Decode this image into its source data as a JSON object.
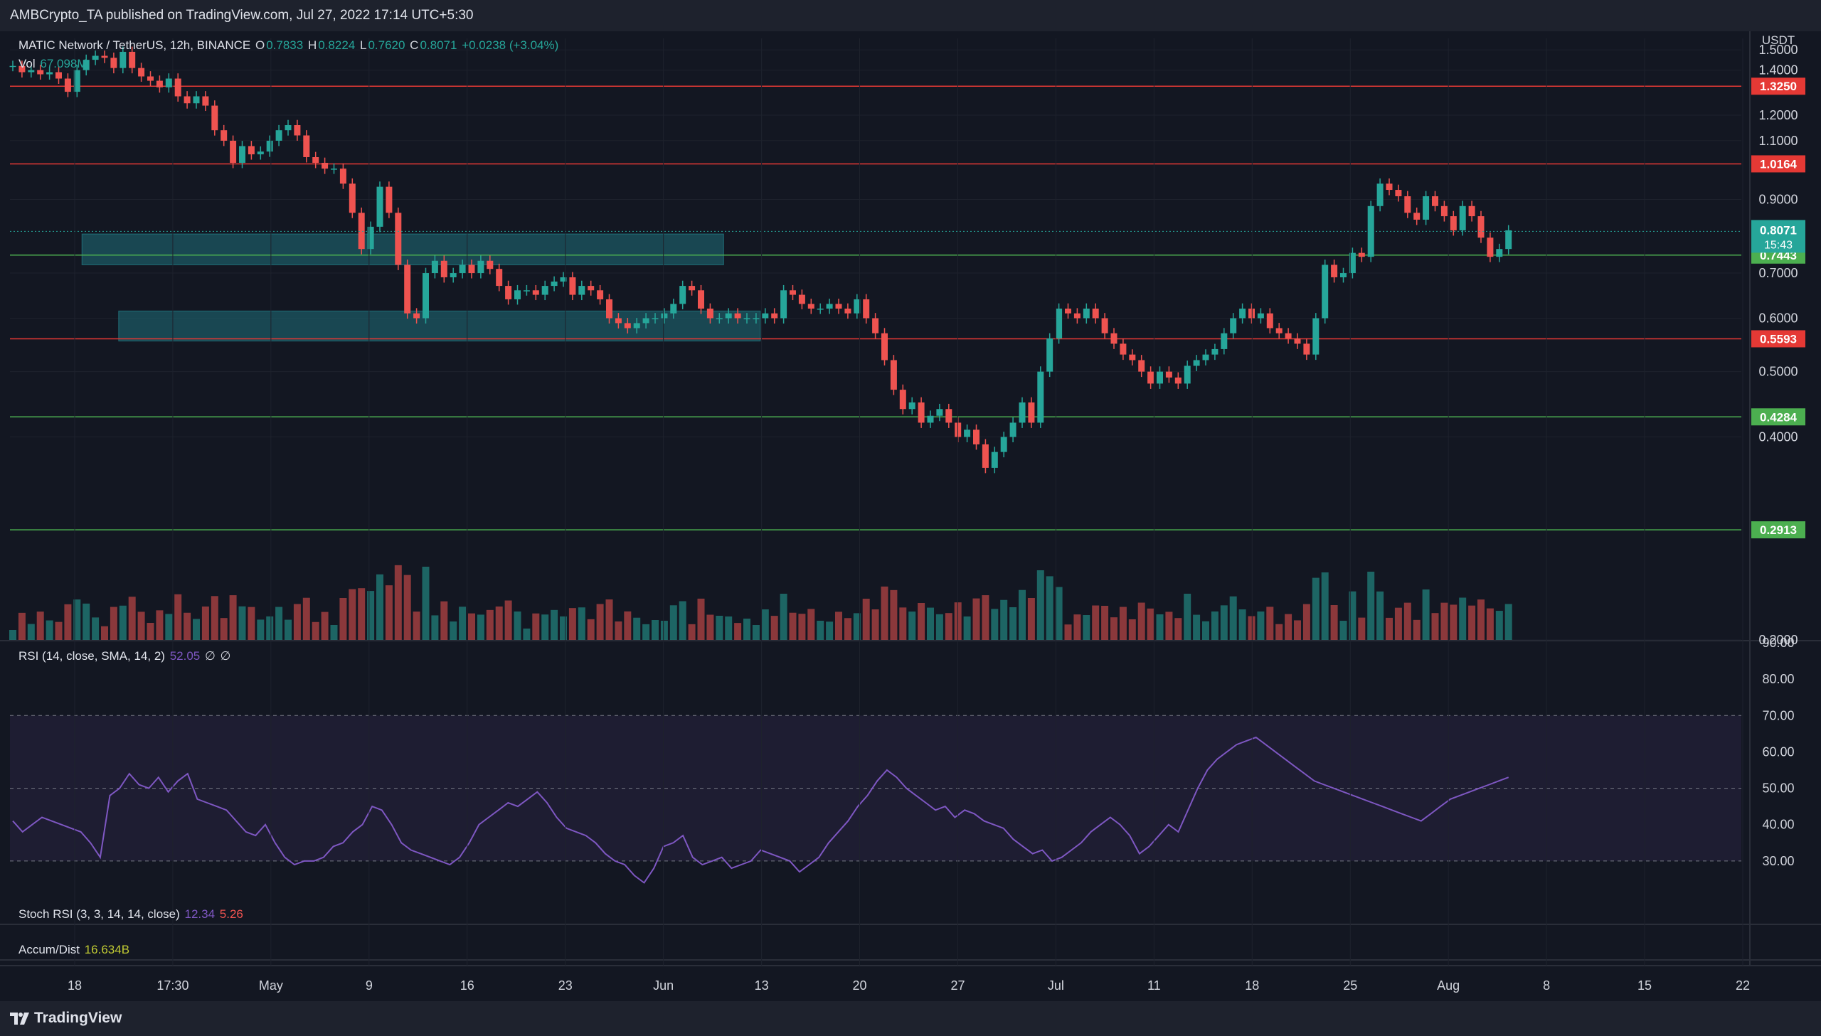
{
  "header": {
    "text": "AMBCrypto_TA published on TradingView.com, Jul 27, 2022 17:14 UTC+5:30"
  },
  "footer": {
    "brand": "TradingView"
  },
  "colors": {
    "bg": "#131722",
    "up": "#26a69a",
    "down": "#ef5350",
    "rsi": "#7e57c2",
    "zone": "#1c5c66",
    "support": "#4caf50",
    "resistance": "#e53935",
    "text": "#d1d4dc"
  },
  "legend": {
    "symbol": "MATIC Network / TetherUS, 12h, BINANCE",
    "o_label": "O",
    "o_val": "0.7833",
    "h_label": "H",
    "h_val": "0.8224",
    "l_label": "L",
    "l_val": "0.7620",
    "c_label": "C",
    "c_val": "0.8071",
    "change": "+0.0238 (+3.04%)",
    "vol_label": "Vol",
    "vol_val": "67.098M"
  },
  "rsi_legend": {
    "label": "RSI (14, close, SMA, 14, 2)",
    "value": "52.05",
    "extra1": "∅",
    "extra2": "∅"
  },
  "stoch_legend": {
    "label": "Stoch RSI (3, 3, 14, 14, close)",
    "k": "12.34",
    "d": "5.26"
  },
  "ad_legend": {
    "label": "Accum/Dist",
    "value": "16.634B"
  },
  "chart_data": [
    {
      "type": "candlestick",
      "currency": "USDT",
      "y_ticks": [
        "1.5000",
        "1.4000",
        "1.2000",
        "1.1000",
        "0.9000",
        "0.7000",
        "0.6000",
        "0.5000",
        "0.4000",
        "0.2000"
      ],
      "x_ticks": [
        "18",
        "17:30",
        "May",
        "9",
        "16",
        "23",
        "Jun",
        "13",
        "20",
        "27",
        "Jul",
        "11",
        "18",
        "25",
        "Aug",
        "8",
        "15",
        "22"
      ],
      "horizontal_levels": [
        {
          "value": 1.325,
          "label": "1.3250",
          "kind": "resistance"
        },
        {
          "value": 1.0164,
          "label": "1.0164",
          "kind": "resistance"
        },
        {
          "value": 0.5593,
          "label": "0.5593",
          "kind": "resistance"
        },
        {
          "value": 0.7443,
          "label": "0.7443",
          "kind": "support"
        },
        {
          "value": 0.4284,
          "label": "0.4284",
          "kind": "support"
        },
        {
          "value": 0.2913,
          "label": "0.2913",
          "kind": "support"
        }
      ],
      "last_price": {
        "value": 0.8071,
        "label": "0.8071",
        "countdown": "15:43"
      },
      "zones": [
        {
          "from_index": 8,
          "to_index": 77,
          "low": 0.72,
          "high": 0.8
        },
        {
          "from_index": 12,
          "to_index": 81,
          "low": 0.555,
          "high": 0.615
        }
      ],
      "closes": [
        1.42,
        1.39,
        1.4,
        1.38,
        1.39,
        1.36,
        1.3,
        1.4,
        1.45,
        1.47,
        1.46,
        1.41,
        1.49,
        1.41,
        1.37,
        1.35,
        1.32,
        1.36,
        1.28,
        1.25,
        1.28,
        1.24,
        1.14,
        1.1,
        1.02,
        1.08,
        1.05,
        1.06,
        1.1,
        1.14,
        1.16,
        1.12,
        1.04,
        1.02,
        1,
        1,
        0.95,
        0.86,
        0.76,
        0.82,
        0.94,
        0.86,
        0.72,
        0.61,
        0.6,
        0.7,
        0.73,
        0.69,
        0.7,
        0.72,
        0.7,
        0.73,
        0.71,
        0.67,
        0.64,
        0.66,
        0.66,
        0.65,
        0.67,
        0.68,
        0.69,
        0.65,
        0.67,
        0.66,
        0.64,
        0.6,
        0.59,
        0.58,
        0.59,
        0.6,
        0.6,
        0.61,
        0.63,
        0.67,
        0.66,
        0.62,
        0.6,
        0.6,
        0.61,
        0.6,
        0.6,
        0.6,
        0.61,
        0.6,
        0.66,
        0.65,
        0.63,
        0.62,
        0.62,
        0.63,
        0.62,
        0.61,
        0.64,
        0.6,
        0.57,
        0.52,
        0.47,
        0.44,
        0.45,
        0.42,
        0.43,
        0.44,
        0.42,
        0.4,
        0.41,
        0.39,
        0.36,
        0.38,
        0.4,
        0.42,
        0.45,
        0.42,
        0.5,
        0.56,
        0.62,
        0.61,
        0.6,
        0.62,
        0.6,
        0.57,
        0.55,
        0.53,
        0.52,
        0.5,
        0.48,
        0.5,
        0.49,
        0.48,
        0.51,
        0.52,
        0.53,
        0.54,
        0.57,
        0.6,
        0.62,
        0.6,
        0.61,
        0.58,
        0.57,
        0.56,
        0.55,
        0.53,
        0.6,
        0.72,
        0.69,
        0.7,
        0.75,
        0.74,
        0.88,
        0.95,
        0.93,
        0.91,
        0.86,
        0.84,
        0.91,
        0.88,
        0.85,
        0.81,
        0.88,
        0.85,
        0.79,
        0.74,
        0.76,
        0.81
      ]
    },
    {
      "type": "line",
      "name": "RSI",
      "y_ticks": [
        "90.00",
        "80.00",
        "70.00",
        "60.00",
        "50.00",
        "40.00",
        "30.00"
      ],
      "band": [
        30,
        70
      ],
      "midline": 50,
      "values": [
        41,
        38,
        40,
        42,
        41,
        40,
        39,
        38,
        35,
        31,
        48,
        50,
        54,
        51,
        50,
        53,
        49,
        52,
        54,
        47,
        46,
        45,
        44,
        41,
        38,
        37,
        40,
        35,
        31,
        29,
        30,
        30,
        31,
        34,
        35,
        38,
        40,
        45,
        44,
        40,
        35,
        33,
        32,
        31,
        30,
        29,
        31,
        35,
        40,
        42,
        44,
        46,
        45,
        47,
        49,
        46,
        42,
        39,
        38,
        37,
        35,
        32,
        30,
        29,
        26,
        24,
        28,
        34,
        35,
        37,
        31,
        29,
        30,
        31,
        28,
        29,
        30,
        33,
        32,
        31,
        30,
        27,
        29,
        31,
        35,
        38,
        41,
        45,
        48,
        52,
        55,
        53,
        50,
        48,
        46,
        44,
        45,
        42,
        44,
        43,
        41,
        40,
        39,
        36,
        34,
        32,
        33,
        30,
        31,
        33,
        35,
        38,
        40,
        42,
        40,
        37,
        32,
        34,
        37,
        40,
        38,
        44,
        50,
        55,
        58,
        60,
        62,
        63,
        64,
        62,
        60,
        58,
        56,
        54,
        52,
        51,
        50,
        49,
        48,
        47,
        46,
        45,
        44,
        43,
        42,
        41,
        43,
        45,
        47,
        48,
        49,
        50,
        51,
        52,
        53
      ]
    },
    {
      "type": "line",
      "name": "Stoch RSI",
      "values": [
        12.34,
        5.26
      ]
    },
    {
      "type": "line",
      "name": "Accum/Dist",
      "values": [
        16.634
      ]
    }
  ]
}
